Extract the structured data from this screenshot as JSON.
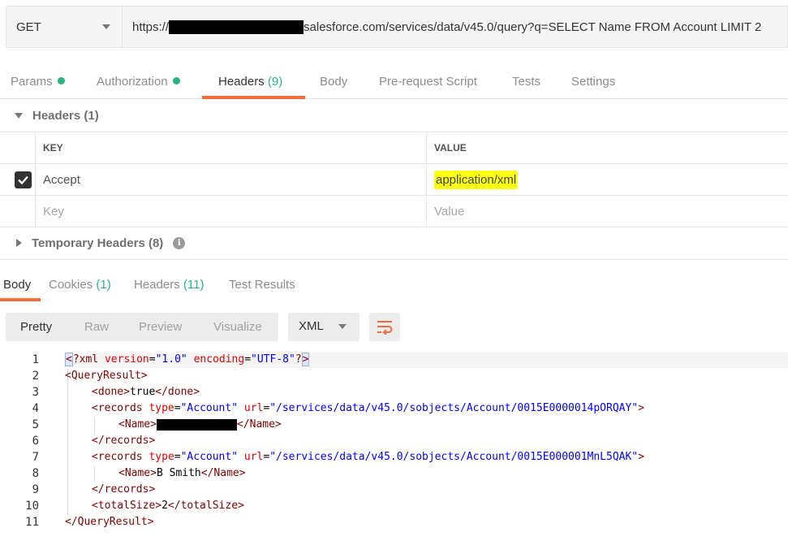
{
  "request": {
    "method": "GET",
    "url_prefix": "https://",
    "url_suffix": "salesforce.com/services/data/v45.0/query?q=SELECT Name FROM Account LIMIT 2"
  },
  "request_tabs": [
    {
      "label": "Params",
      "dot": true
    },
    {
      "label": "Authorization",
      "dot": true
    },
    {
      "label": "Headers",
      "count": "(9)",
      "active": true
    },
    {
      "label": "Body"
    },
    {
      "label": "Pre-request Script"
    },
    {
      "label": "Tests"
    },
    {
      "label": "Settings"
    }
  ],
  "headers_section": {
    "title": "Headers (1)",
    "col_key": "KEY",
    "col_value": "VALUE",
    "rows": [
      {
        "checked": true,
        "key": "Accept",
        "value": "application/xml"
      }
    ],
    "placeholder_key": "Key",
    "placeholder_value": "Value"
  },
  "temporary_headers": {
    "title": "Temporary Headers (8)"
  },
  "response_tabs": [
    {
      "label": "Body",
      "active": true
    },
    {
      "label": "Cookies",
      "count": "(1)"
    },
    {
      "label": "Headers",
      "count": "(11)"
    },
    {
      "label": "Test Results"
    }
  ],
  "body_toolbar": {
    "modes": [
      "Pretty",
      "Raw",
      "Preview",
      "Visualize"
    ],
    "active_mode": "Pretty",
    "format": "XML"
  },
  "code": {
    "line_numbers": [
      "1",
      "2",
      "3",
      "4",
      "5",
      "6",
      "7",
      "8",
      "9",
      "10",
      "11"
    ],
    "xml_decl": {
      "tag": "?xml",
      "attr1": "version",
      "val1": "\"1.0\"",
      "attr2": "encoding",
      "val2": "\"UTF-8\""
    },
    "root": "QueryResult",
    "done": "true",
    "record1_type": "\"Account\"",
    "record1_url": "\"/services/data/v45.0/sobjects/Account/0015E0000014pORQAY\"",
    "record2_type": "\"Account\"",
    "record2_url": "\"/services/data/v45.0/sobjects/Account/0015E000001MnL5QAK\"",
    "record2_name": "B Smith",
    "total_size": "2"
  },
  "colors": {
    "accent": "#f26b3a",
    "status_green": "#26b47f",
    "highlight": "#fbff16"
  }
}
